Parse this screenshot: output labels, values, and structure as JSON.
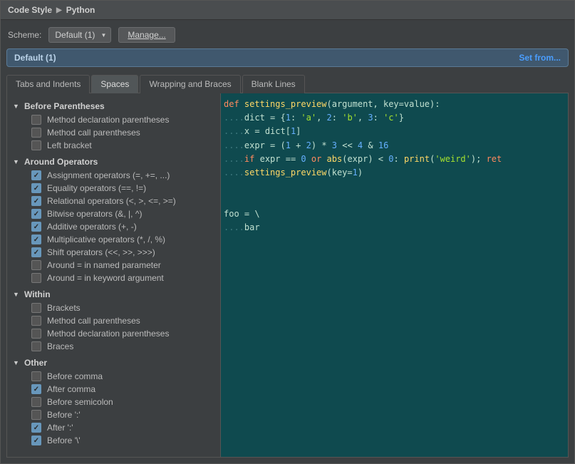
{
  "breadcrumb": {
    "parent": "Code Style",
    "child": "Python"
  },
  "scheme": {
    "label": "Scheme:",
    "value": "Default (1)",
    "manage": "Manage..."
  },
  "banner": {
    "title": "Default (1)",
    "setFrom": "Set from..."
  },
  "tabs": [
    {
      "label": "Tabs and Indents",
      "active": false
    },
    {
      "label": "Spaces",
      "active": true
    },
    {
      "label": "Wrapping and Braces",
      "active": false
    },
    {
      "label": "Blank Lines",
      "active": false
    }
  ],
  "groups": [
    {
      "title": "Before Parentheses",
      "expanded": true,
      "items": [
        {
          "label": "Method declaration parentheses",
          "checked": false
        },
        {
          "label": "Method call parentheses",
          "checked": false
        },
        {
          "label": "Left bracket",
          "checked": false
        }
      ]
    },
    {
      "title": "Around Operators",
      "expanded": true,
      "items": [
        {
          "label": "Assignment operators (=, +=, ...)",
          "checked": true
        },
        {
          "label": "Equality operators (==, !=)",
          "checked": true
        },
        {
          "label": "Relational operators (<, >, <=, >=)",
          "checked": true
        },
        {
          "label": "Bitwise operators (&, |, ^)",
          "checked": true
        },
        {
          "label": "Additive operators (+, -)",
          "checked": true
        },
        {
          "label": "Multiplicative operators (*, /, %)",
          "checked": true
        },
        {
          "label": "Shift operators (<<, >>, >>>)",
          "checked": true
        },
        {
          "label": "Around = in named parameter",
          "checked": false
        },
        {
          "label": "Around = in keyword argument",
          "checked": false
        }
      ]
    },
    {
      "title": "Within",
      "expanded": true,
      "items": [
        {
          "label": "Brackets",
          "checked": false
        },
        {
          "label": "Method call parentheses",
          "checked": false
        },
        {
          "label": "Method declaration parentheses",
          "checked": false
        },
        {
          "label": "Braces",
          "checked": false
        }
      ]
    },
    {
      "title": "Other",
      "expanded": true,
      "items": [
        {
          "label": "Before comma",
          "checked": false
        },
        {
          "label": "After comma",
          "checked": true
        },
        {
          "label": "Before semicolon",
          "checked": false
        },
        {
          "label": "Before ':'",
          "checked": false
        },
        {
          "label": "After ':'",
          "checked": true
        },
        {
          "label": "Before '\\'",
          "checked": true
        }
      ]
    }
  ],
  "code": {
    "lines": [
      {
        "segments": [
          {
            "t": "def ",
            "c": "kw"
          },
          {
            "t": "settings_preview",
            "c": "fn"
          },
          {
            "t": "(argument, key",
            "c": "op"
          },
          {
            "t": "=",
            "c": "op"
          },
          {
            "t": "value):",
            "c": "op"
          }
        ]
      },
      {
        "indent": 1,
        "segments": [
          {
            "t": "dict ",
            "c": "op"
          },
          {
            "t": "= {",
            "c": "op"
          },
          {
            "t": "1",
            "c": "num"
          },
          {
            "t": ": ",
            "c": "op"
          },
          {
            "t": "'a'",
            "c": "str"
          },
          {
            "t": ", ",
            "c": "op"
          },
          {
            "t": "2",
            "c": "num"
          },
          {
            "t": ": ",
            "c": "op"
          },
          {
            "t": "'b'",
            "c": "str"
          },
          {
            "t": ", ",
            "c": "op"
          },
          {
            "t": "3",
            "c": "num"
          },
          {
            "t": ": ",
            "c": "op"
          },
          {
            "t": "'c'",
            "c": "str"
          },
          {
            "t": "}",
            "c": "op"
          }
        ]
      },
      {
        "indent": 1,
        "segments": [
          {
            "t": "x ",
            "c": "op"
          },
          {
            "t": "= ",
            "c": "op"
          },
          {
            "t": "dict[",
            "c": "op"
          },
          {
            "t": "1",
            "c": "num"
          },
          {
            "t": "]",
            "c": "op"
          }
        ]
      },
      {
        "indent": 1,
        "segments": [
          {
            "t": "expr ",
            "c": "op"
          },
          {
            "t": "= (",
            "c": "op"
          },
          {
            "t": "1",
            "c": "num"
          },
          {
            "t": " + ",
            "c": "op"
          },
          {
            "t": "2",
            "c": "num"
          },
          {
            "t": ") * ",
            "c": "op"
          },
          {
            "t": "3",
            "c": "num"
          },
          {
            "t": " << ",
            "c": "op"
          },
          {
            "t": "4",
            "c": "num"
          },
          {
            "t": " & ",
            "c": "op"
          },
          {
            "t": "16",
            "c": "num"
          }
        ]
      },
      {
        "indent": 1,
        "segments": [
          {
            "t": "if ",
            "c": "kw"
          },
          {
            "t": "expr ",
            "c": "op"
          },
          {
            "t": "== ",
            "c": "op"
          },
          {
            "t": "0",
            "c": "num"
          },
          {
            "t": " or ",
            "c": "kw"
          },
          {
            "t": "abs",
            "c": "fn"
          },
          {
            "t": "(expr) < ",
            "c": "op"
          },
          {
            "t": "0",
            "c": "num"
          },
          {
            "t": ": ",
            "c": "op"
          },
          {
            "t": "print",
            "c": "fn"
          },
          {
            "t": "(",
            "c": "op"
          },
          {
            "t": "'weird'",
            "c": "str"
          },
          {
            "t": "); ",
            "c": "op"
          },
          {
            "t": "ret",
            "c": "kw"
          }
        ]
      },
      {
        "indent": 1,
        "segments": [
          {
            "t": "settings_preview",
            "c": "fn"
          },
          {
            "t": "(key",
            "c": "op"
          },
          {
            "t": "=",
            "c": "op"
          },
          {
            "t": "1",
            "c": "num"
          },
          {
            "t": ")",
            "c": "op"
          }
        ]
      },
      {
        "blank": true
      },
      {
        "blank": true
      },
      {
        "segments": [
          {
            "t": "foo ",
            "c": "op"
          },
          {
            "t": "= \\",
            "c": "op"
          }
        ]
      },
      {
        "indent": 1,
        "segments": [
          {
            "t": "bar",
            "c": "op"
          }
        ]
      }
    ]
  }
}
